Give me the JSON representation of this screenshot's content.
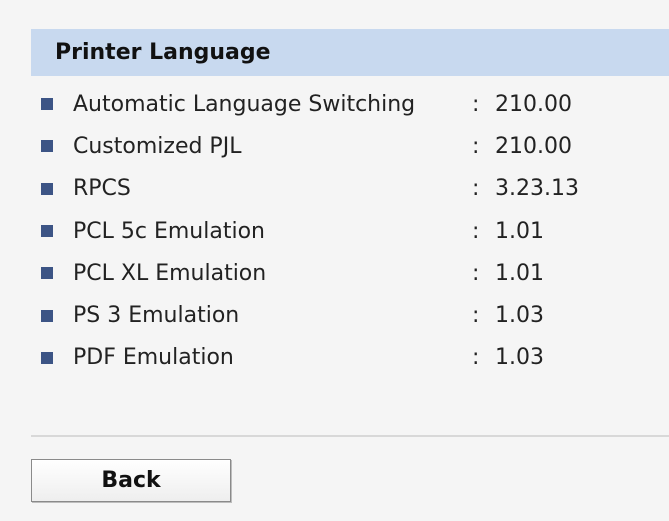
{
  "section": {
    "title": "Printer Language"
  },
  "rows": [
    {
      "label": "Automatic Language Switching",
      "separator": ":",
      "value": "210.00"
    },
    {
      "label": "Customized PJL",
      "separator": ":",
      "value": "210.00"
    },
    {
      "label": "RPCS",
      "separator": ":",
      "value": "3.23.13"
    },
    {
      "label": "PCL 5c Emulation",
      "separator": ":",
      "value": "1.01"
    },
    {
      "label": "PCL XL Emulation",
      "separator": ":",
      "value": "1.01"
    },
    {
      "label": "PS 3 Emulation",
      "separator": ":",
      "value": "1.03"
    },
    {
      "label": "PDF Emulation",
      "separator": ":",
      "value": "1.03"
    }
  ],
  "buttons": {
    "back_label": "Back"
  },
  "colors": {
    "header_background": "#c8d9ef",
    "bullet": "#3c5485",
    "page_background": "#f5f5f5"
  }
}
